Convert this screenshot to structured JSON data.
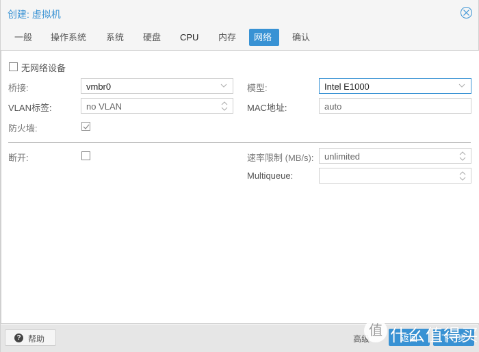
{
  "window": {
    "title": "创建: 虚拟机",
    "close_icon": "circle-x-icon"
  },
  "tabs": [
    {
      "label": "一般",
      "active": false
    },
    {
      "label": "操作系统",
      "active": false
    },
    {
      "label": "系统",
      "active": false
    },
    {
      "label": "硬盘",
      "active": false
    },
    {
      "label": "CPU",
      "active": false
    },
    {
      "label": "内存",
      "active": false
    },
    {
      "label": "网络",
      "active": true
    },
    {
      "label": "确认",
      "active": false
    }
  ],
  "form": {
    "no_network": {
      "label": "无网络设备",
      "checked": false
    },
    "bridge": {
      "label": "桥接:",
      "value": "vmbr0"
    },
    "vlan": {
      "label": "VLAN标签:",
      "value": "no VLAN"
    },
    "firewall": {
      "label": "防火墙:",
      "checked": true
    },
    "model": {
      "label": "模型:",
      "value": "Intel E1000"
    },
    "mac": {
      "label": "MAC地址:",
      "value": "auto"
    },
    "disconnect": {
      "label": "断开:",
      "checked": false
    },
    "rate_limit": {
      "label": "速率限制 (MB/s):",
      "value": "unlimited"
    },
    "multiqueue": {
      "label": "Multiqueue:",
      "value": ""
    }
  },
  "footer": {
    "help_label": "帮助",
    "help_icon": "question-circle-icon",
    "advanced_label": "高级",
    "back_label": "返回",
    "next_label": "下一步"
  },
  "watermark": {
    "badge": "值",
    "text": "什么值得买"
  },
  "colors": {
    "accent": "#3892d4",
    "footer_bg": "#e6e6e6"
  }
}
